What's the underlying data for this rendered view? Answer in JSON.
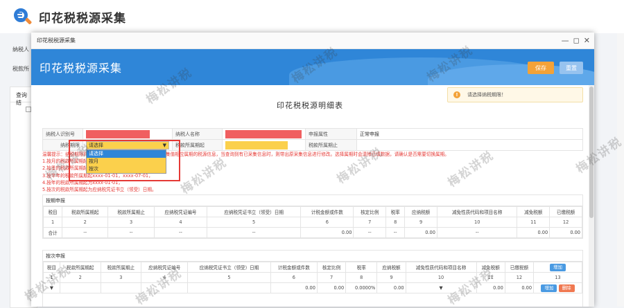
{
  "bg": {
    "title": "印花税税源采集",
    "row1_label": "纳税人",
    "row2_label": "税款所",
    "panel_label": "查询结"
  },
  "modal": {
    "window_title": "印花税税源采集",
    "banner_title": "印花税税源采集",
    "save": "保存",
    "reset": "重置",
    "hint": "请选择纳税期限！",
    "main_title": "印花税税源明细表"
  },
  "info": {
    "taxpayer_id_label": "纳税人识别号",
    "taxpayer_name_label": "纳税人名称",
    "declare_attr_label": "申报属性",
    "declare_attr_value": "正常申报",
    "period_label": "纳税期限",
    "period_start_label": "税款所属期起",
    "period_end_label": "税款所属期止",
    "period_select": "请选择",
    "period_options": [
      "请选择",
      "按月",
      "按次"
    ]
  },
  "warn_lines": [
    "温馨提示：纳税期限时，系统自动检测税款所属期之前所有采集值相应属期的税源信息，当查询到有已采集信息时，则带出原采集信息进行修改。选择属期时会清除已填数据，请确认是否需要切换属期。",
    "1.按月的税款所属期起",
    "2.按季的税款所属期起为xxxx-10-01，",
    "3.按半年的税款所属期起xxxx-01-01，xxxx-07-01，",
    "4.按年的税款所属期起为xxxx-01-01，",
    "5.按次的税款所属期起为应纳税凭证书立（领受）日期。"
  ],
  "monthly": {
    "title": "按期申报",
    "headers": [
      "税目",
      "税款所属期起",
      "税款所属期止",
      "应纳税凭证编号",
      "应纳税凭证书立（领受）日期",
      "计税金额或件数",
      "核定比例",
      "税率",
      "应纳税额",
      "减免性质代码和项目名称",
      "减免税额",
      "已缴税额"
    ],
    "nums": [
      "1",
      "2",
      "3",
      "4",
      "5",
      "6",
      "7",
      "8",
      "9",
      "10",
      "11",
      "12"
    ],
    "total": [
      "合计",
      "--",
      "--",
      "--",
      "--",
      "0.00",
      "--",
      "--",
      "0.00",
      "--",
      "0.00",
      "0.00"
    ]
  },
  "per_time": {
    "title": "按次申报",
    "headers": [
      "税目",
      "税款所属期起",
      "税款所属期止",
      "应纳税凭证编号",
      "应纳税凭证书立（领受）日期",
      "计税金额或件数",
      "核定比例",
      "税率",
      "应纳税额",
      "减免性质代码和项目名称",
      "减免税额",
      "已缴税额",
      "增加"
    ],
    "nums": [
      "1",
      "2",
      "3",
      "4",
      "5",
      "6",
      "7",
      "8",
      "9",
      "10",
      "11",
      "12",
      "13"
    ],
    "row": [
      "",
      "",
      "",
      "",
      "",
      "0.00",
      "0.00",
      "0.0000%",
      "0.00",
      "",
      "0.00",
      "0.00"
    ],
    "add": "增加",
    "del": "删除"
  },
  "watermark": "梅松讲税"
}
